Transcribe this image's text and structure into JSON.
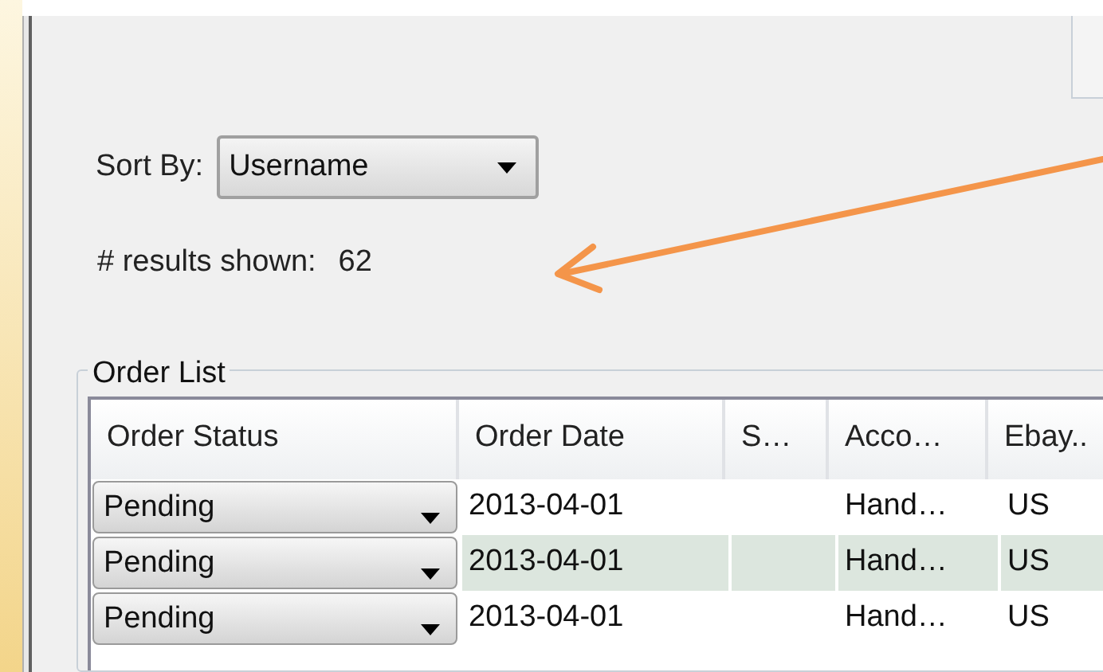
{
  "sort": {
    "label": "Sort By:",
    "value": "Username"
  },
  "results": {
    "label": "# results shown:",
    "count": "62"
  },
  "order_list": {
    "title": "Order List",
    "columns": [
      "Order Status",
      "Order Date",
      "S…",
      "Acco…",
      "Ebay.."
    ],
    "rows": [
      {
        "status": "Pending",
        "date": "2013-04-01",
        "column_3": "",
        "account": "Hand…",
        "ebay": "US"
      },
      {
        "status": "Pending",
        "date": "2013-04-01",
        "column_3": "",
        "account": "Hand…",
        "ebay": "US"
      },
      {
        "status": "Pending",
        "date": "2013-04-01",
        "column_3": "",
        "account": "Hand…",
        "ebay": "US"
      }
    ]
  }
}
